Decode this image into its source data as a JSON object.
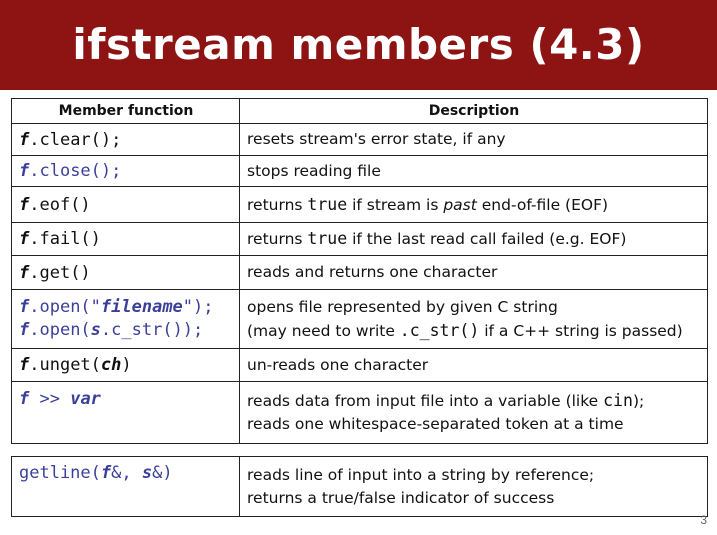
{
  "slide": {
    "title": "ifstream members (4.3)",
    "page_number": "3"
  },
  "colors": {
    "title_bar": "#8e1414",
    "code_blue": "#3a3f9a"
  },
  "table": {
    "headers": [
      "Member function",
      "Description"
    ],
    "rows": [
      {
        "func": [
          [
            "f",
            "b"
          ],
          [
            ".clear();",
            "n"
          ]
        ],
        "desc": [
          [
            [
              "resets stream's error state, if any",
              "t"
            ]
          ]
        ]
      },
      {
        "func": [
          [
            "f",
            "b"
          ],
          [
            ".close();",
            "n"
          ]
        ],
        "desc": [
          [
            [
              "stops reading file",
              "t"
            ]
          ]
        ]
      },
      {
        "func": [
          [
            "f",
            "b"
          ],
          [
            ".eof()",
            "n"
          ]
        ],
        "desc": [
          [
            [
              "returns ",
              "t"
            ],
            [
              "true",
              "m"
            ],
            [
              " if stream is ",
              "t"
            ],
            [
              "past",
              "i"
            ],
            [
              " end-of-file (EOF)",
              "t"
            ]
          ]
        ]
      },
      {
        "func": [
          [
            "f",
            "b"
          ],
          [
            ".fail()",
            "n"
          ]
        ],
        "desc": [
          [
            [
              "returns ",
              "t"
            ],
            [
              "true",
              "m"
            ],
            [
              " if the last read call failed (e.g. EOF)",
              "t"
            ]
          ]
        ]
      },
      {
        "func": [
          [
            "f",
            "b"
          ],
          [
            ".get()",
            "n"
          ]
        ],
        "desc": [
          [
            [
              "reads and returns one character",
              "t"
            ]
          ]
        ]
      },
      {
        "func_lines": [
          [
            [
              "f",
              "b"
            ],
            [
              ".open(\"",
              "n"
            ],
            [
              "filename",
              "b"
            ],
            [
              "\");",
              "n"
            ]
          ],
          [
            [
              "f",
              "b"
            ],
            [
              ".open(",
              "n"
            ],
            [
              "s",
              "b"
            ],
            [
              ".c_str());",
              "n"
            ]
          ]
        ],
        "desc": [
          [
            [
              "opens file represented by given C string",
              "t"
            ]
          ],
          [
            [
              "(may need to write ",
              "t"
            ],
            [
              ".c_str()",
              "m"
            ],
            [
              " if a C++ string is passed)",
              "t"
            ]
          ]
        ]
      },
      {
        "func": [
          [
            "f",
            "b"
          ],
          [
            ".unget(",
            "n"
          ],
          [
            "ch",
            "b"
          ],
          [
            ")",
            "n"
          ]
        ],
        "desc": [
          [
            [
              "un-reads one character",
              "t"
            ]
          ]
        ]
      },
      {
        "func": [
          [
            "f",
            "b"
          ],
          [
            " >> ",
            "n"
          ],
          [
            "var",
            "b"
          ]
        ],
        "desc": [
          [
            [
              "reads data from input file into a variable (like ",
              "t"
            ],
            [
              "cin",
              "m"
            ],
            [
              ");",
              "t"
            ]
          ],
          [
            [
              "reads one whitespace-separated token at a time",
              "t"
            ]
          ]
        ]
      }
    ]
  },
  "getline": {
    "func": [
      [
        "getline(",
        "n"
      ],
      [
        "f",
        "b"
      ],
      [
        "&, ",
        "n"
      ],
      [
        "s",
        "b"
      ],
      [
        "&)",
        "n"
      ]
    ],
    "desc": [
      [
        [
          "reads line of input into a string by reference;",
          "t"
        ]
      ],
      [
        [
          "returns a true/false indicator of success",
          "t"
        ]
      ]
    ]
  }
}
